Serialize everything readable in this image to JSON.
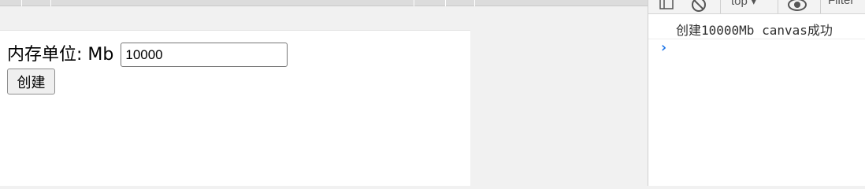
{
  "page": {
    "label": "内存单位: Mb",
    "input_value": "10000",
    "button_label": "创建"
  },
  "devtools": {
    "context_selector": "top ▾",
    "filter_placeholder": "Filter",
    "console": {
      "messages": [
        "创建10000Mb canvas成功"
      ],
      "prompt_symbol": "›"
    }
  },
  "colors": {
    "prompt": "#1a73e8",
    "page_background": "#ffffff",
    "chrome_background": "#f1f1f1"
  }
}
